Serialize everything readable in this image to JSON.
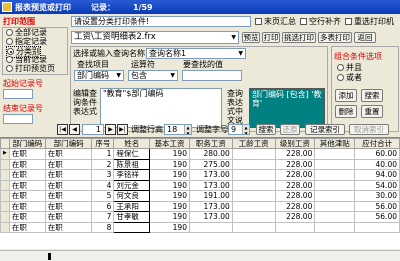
{
  "window": {
    "title": "报表预览或打印",
    "record_label": "记录：",
    "record_value": "1/59"
  },
  "filter_input": {
    "value": "请设置分类打印条件!"
  },
  "checkboxes": [
    {
      "label": "末页汇总"
    },
    {
      "label": "空行补齐"
    },
    {
      "label": "重选打印机"
    }
  ],
  "print_range": {
    "title": "打印范围",
    "options": [
      "全部记录",
      "指定记录",
      "分类别",
      "当前记录",
      "打印预览页"
    ],
    "selected_index": 2
  },
  "start_record_label": "起始记录号",
  "end_record_label": "结束记录号",
  "report_file": {
    "value": "工资\\工资明细表2.frx"
  },
  "toolbar": {
    "preview": "预览",
    "print": "打印",
    "pick_print": "挑选打印",
    "multi_print": "多表打印",
    "back": "返回"
  },
  "query": {
    "select_label": "选择或输入查询名称",
    "select_value": "查询名称1",
    "find_item_label": "查找项目",
    "find_item_value": "部门编码",
    "operator_label": "运算符",
    "operator_value": "包含",
    "find_value_label": "要查找的值",
    "find_value_value": ""
  },
  "combo": {
    "title": "组合条件选项",
    "and_label": "并且",
    "or_label": "或者"
  },
  "expr": {
    "edit_label": "编辑查询条件表达式",
    "edit_value": "\"教育\"$部门编码",
    "desc_label": "查询表达式中文说明",
    "desc_value": "部门编码 [包含] '教育'"
  },
  "actions": {
    "add": "添加",
    "replace": "搜索",
    "delete": "删除",
    "reset": "重置"
  },
  "nav": {
    "page_value": "1",
    "row_height_label": "调整行高",
    "row_height_value": "18",
    "font_label": "调整字号",
    "font_value": "9",
    "search": "搜索",
    "restore": "还原",
    "record_index": "记录索引",
    "cancel_index": "取消索引"
  },
  "table": {
    "columns": [
      "部门编码",
      "部门编码",
      "序号",
      "姓名",
      "基本工资",
      "职务工资",
      "工龄工资",
      "级别工资",
      "其他津贴",
      "应付合计"
    ],
    "rows": [
      [
        "在职",
        "在职",
        "1",
        "程保仁",
        "190",
        "280.00",
        "",
        "228.00",
        "",
        "60.00"
      ],
      [
        "在职",
        "在职",
        "2",
        "陈景祖",
        "190",
        "275.00",
        "",
        "228.00",
        "",
        "40.00"
      ],
      [
        "在职",
        "在职",
        "3",
        "李铭祥",
        "190",
        "173.00",
        "",
        "228.00",
        "",
        "94.00"
      ],
      [
        "在职",
        "在职",
        "4",
        "刘元金",
        "190",
        "173.00",
        "",
        "228.00",
        "",
        "54.00"
      ],
      [
        "在职",
        "在职",
        "5",
        "何文良",
        "190",
        "191.00",
        "",
        "228.00",
        "",
        "30.00"
      ],
      [
        "在职",
        "在职",
        "6",
        "王承阳",
        "190",
        "173.00",
        "",
        "228.00",
        "",
        "56.00"
      ],
      [
        "在职",
        "在职",
        "7",
        "甘孝敏",
        "190",
        "173.00",
        "",
        "228.00",
        "",
        "56.00"
      ],
      [
        "在职",
        "在职",
        "8",
        "",
        "190",
        "",
        "",
        "",
        "",
        ""
      ]
    ]
  }
}
